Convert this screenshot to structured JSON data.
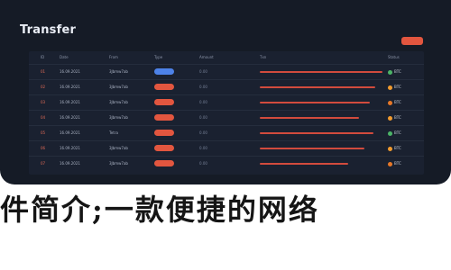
{
  "header": {
    "title": "Transfer",
    "top_button": ""
  },
  "table": {
    "columns": [
      "ID",
      "Date",
      "From",
      "Type",
      "Amount",
      "Txn",
      "Status"
    ],
    "rows": [
      {
        "id": "01",
        "date": "16.09.2021",
        "address": "3Jbmw7ab",
        "badge": "",
        "meta": "0.00",
        "line": 0.92,
        "status": "BTC"
      },
      {
        "id": "02",
        "date": "16.09.2021",
        "address": "3Jbmw7ab",
        "badge": "",
        "meta": "0.00",
        "line": 0.86,
        "status": "BTC"
      },
      {
        "id": "03",
        "date": "16.09.2021",
        "address": "3Jbmw7ab",
        "badge": "",
        "meta": "0.00",
        "line": 0.82,
        "status": "BTC"
      },
      {
        "id": "04",
        "date": "16.09.2021",
        "address": "3Jbmw7ab",
        "badge": "",
        "meta": "0.00",
        "line": 0.74,
        "status": "BTC"
      },
      {
        "id": "05",
        "date": "16.09.2021",
        "address": "Tetra",
        "badge": "",
        "meta": "0.00",
        "line": 0.84,
        "status": "BTC"
      },
      {
        "id": "06",
        "date": "16.09.2021",
        "address": "3Jbmw7ab",
        "badge": "",
        "meta": "0.00",
        "line": 0.78,
        "status": "BTC"
      },
      {
        "id": "07",
        "date": "16.09.2021",
        "address": "3Jbmw7ab",
        "badge": "",
        "meta": "0.00",
        "line": 0.66,
        "status": "BTC"
      }
    ]
  },
  "caption": "件简介;一款便捷的网络"
}
